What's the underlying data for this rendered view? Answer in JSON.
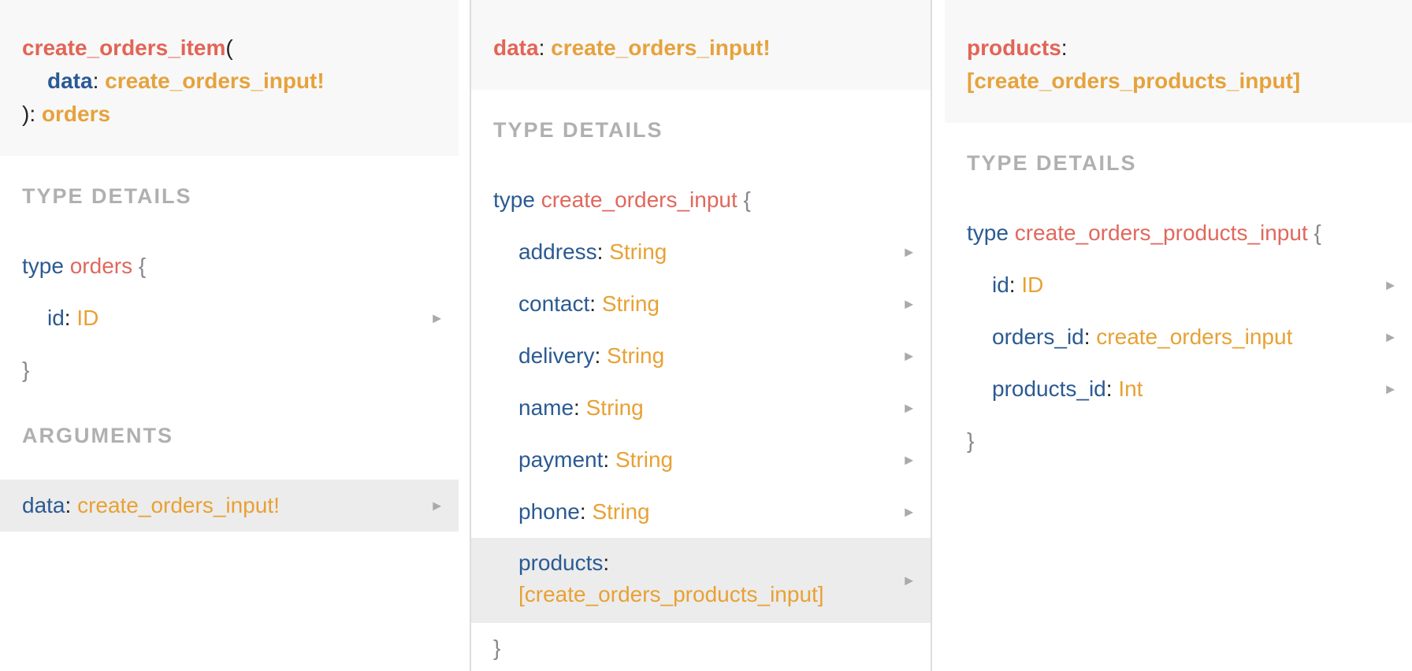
{
  "col1": {
    "header": {
      "field": "create_orders_item",
      "open_paren": "(",
      "arg_name": "data",
      "colon": ":",
      "arg_type": "create_orders_input!",
      "close": "):",
      "return_type": "orders"
    },
    "type_details_title": "TYPE DETAILS",
    "type_kw": "type",
    "type_name": "orders",
    "open_brace": "{",
    "close_brace": "}",
    "fields": [
      {
        "name": "id",
        "type": "ID"
      }
    ],
    "arguments_title": "ARGUMENTS",
    "argument": {
      "name": "data",
      "type": "create_orders_input!"
    },
    "arrow": "▶"
  },
  "col2": {
    "header": {
      "name": "data",
      "colon": ":",
      "type": "create_orders_input!"
    },
    "type_details_title": "TYPE DETAILS",
    "type_kw": "type",
    "type_name": "create_orders_input",
    "open_brace": "{",
    "close_brace": "}",
    "fields": [
      {
        "name": "address",
        "type": "String"
      },
      {
        "name": "contact",
        "type": "String"
      },
      {
        "name": "delivery",
        "type": "String"
      },
      {
        "name": "name",
        "type": "String"
      },
      {
        "name": "payment",
        "type": "String"
      },
      {
        "name": "phone",
        "type": "String"
      },
      {
        "name": "products",
        "type": "[create_orders_products_input]"
      }
    ],
    "arrow": "▶"
  },
  "col3": {
    "header": {
      "name": "products",
      "colon": ":",
      "type": "[create_orders_products_input]"
    },
    "type_details_title": "TYPE DETAILS",
    "type_kw": "type",
    "type_name": "create_orders_products_input",
    "open_brace": "{",
    "close_brace": "}",
    "fields": [
      {
        "name": "id",
        "type": "ID"
      },
      {
        "name": "orders_id",
        "type": "create_orders_input"
      },
      {
        "name": "products_id",
        "type": "Int"
      }
    ],
    "arrow": "▶"
  },
  "colon": ":"
}
